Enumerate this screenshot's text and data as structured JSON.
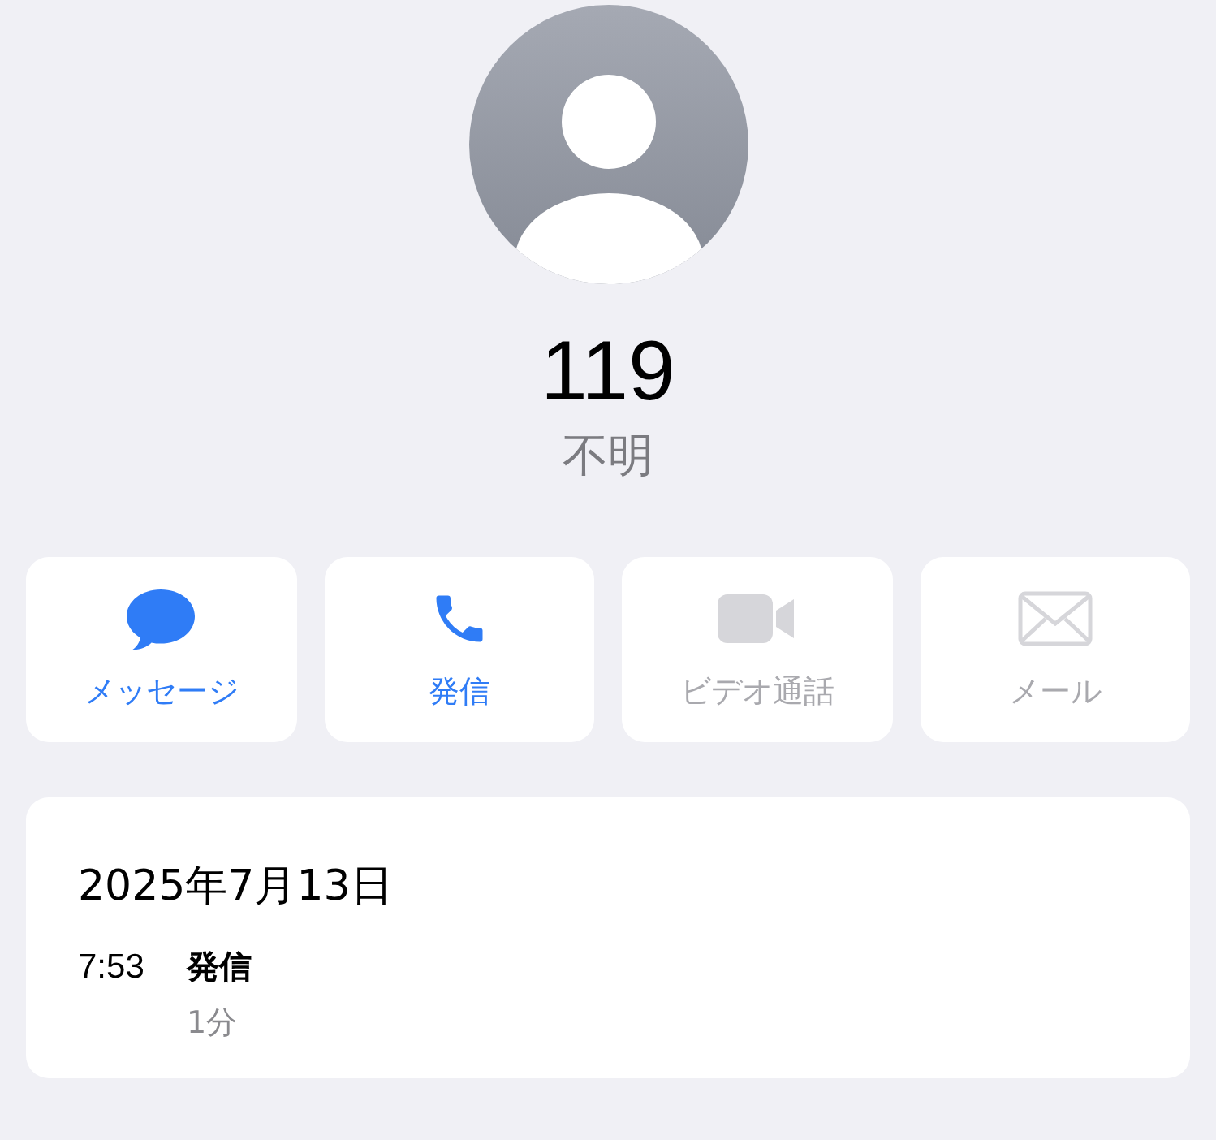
{
  "contact": {
    "name": "119",
    "label": "不明"
  },
  "actions": [
    {
      "kind": "message",
      "label": "メッセージ",
      "disabled": false
    },
    {
      "kind": "call",
      "label": "発信",
      "disabled": false
    },
    {
      "kind": "video",
      "label": "ビデオ通話",
      "disabled": true
    },
    {
      "kind": "mail",
      "label": "メール",
      "disabled": true
    }
  ],
  "history": {
    "date": "2025年7月13日",
    "entries": [
      {
        "time": "7:53",
        "type": "発信",
        "duration": "1分"
      }
    ]
  }
}
